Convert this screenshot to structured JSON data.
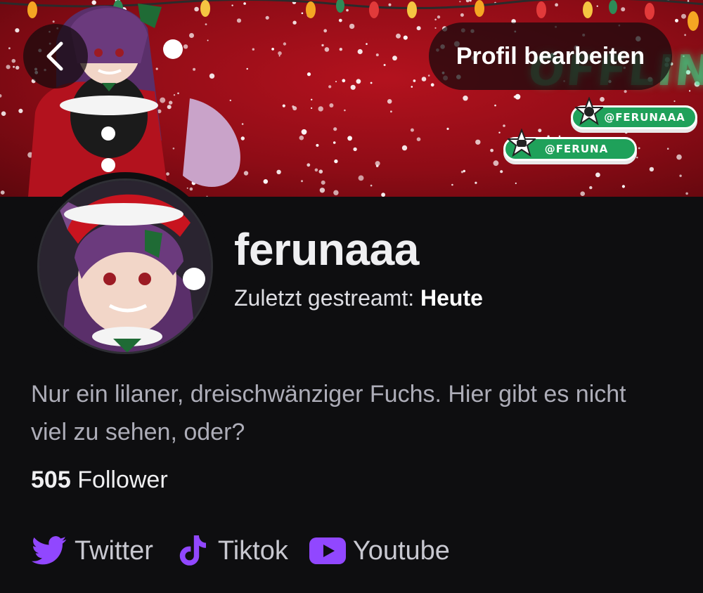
{
  "header": {
    "edit_profile_label": "Profil bearbeiten"
  },
  "banner": {
    "offline_text": "OFFLINE",
    "tags": [
      {
        "handle": "@FERUNAAA",
        "icon": "twitter-icon"
      },
      {
        "handle": "@FERUNA",
        "icon": "youtube-icon"
      }
    ]
  },
  "profile": {
    "username": "ferunaaa",
    "last_streamed_label": "Zuletzt gestreamt:",
    "last_streamed_value": "Heute",
    "bio": "Nur ein lilaner, dreischwänziger Fuchs. Hier gibt es nicht viel zu sehen, oder?",
    "followers_count": "505",
    "followers_label": "Follower"
  },
  "links": [
    {
      "label": "Twitter",
      "icon": "twitter-icon"
    },
    {
      "label": "Tiktok",
      "icon": "tiktok-icon"
    },
    {
      "label": "Youtube",
      "icon": "youtube-icon"
    }
  ],
  "colors": {
    "accent": "#9147ff",
    "background": "#0e0e10",
    "banner_red": "#a1101b",
    "tag_green": "#1fa15a"
  }
}
